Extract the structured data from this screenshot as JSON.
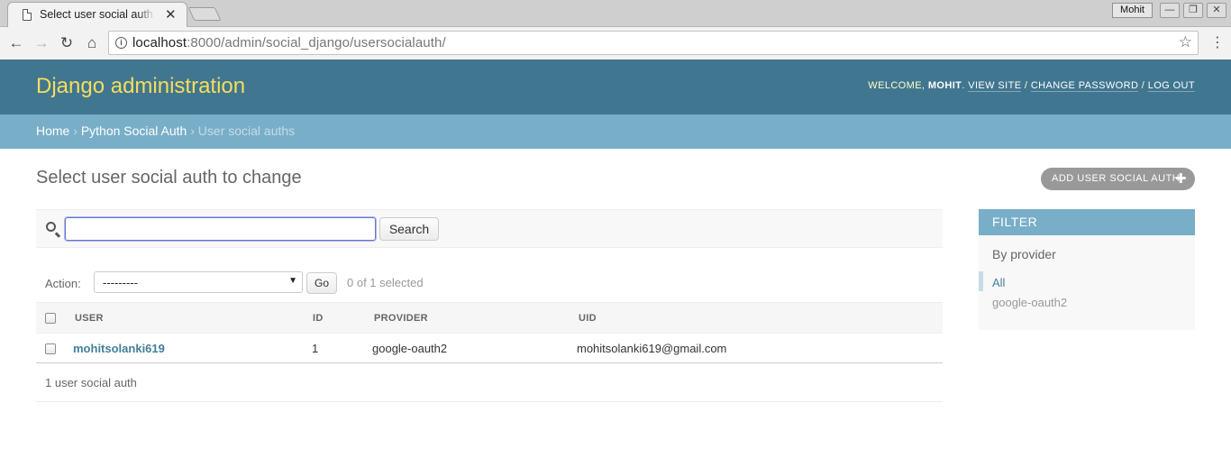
{
  "browser": {
    "tab_title": "Select user social auth to change",
    "profile_name": "Mohit",
    "url_host": "localhost",
    "url_rest": ":8000/admin/social_django/usersocialauth/"
  },
  "header": {
    "branding": "Django administration",
    "welcome": "WELCOME,",
    "username": "MOHIT",
    "view_site": "VIEW SITE",
    "change_password": "CHANGE PASSWORD",
    "log_out": "LOG OUT",
    "separator": " / "
  },
  "breadcrumbs": {
    "home": "Home",
    "app": "Python Social Auth",
    "current": "User social auths",
    "separator": " › "
  },
  "content": {
    "title": "Select user social auth to change",
    "add_button": "ADD USER SOCIAL AUTH"
  },
  "search": {
    "value": "",
    "button_label": "Search"
  },
  "actions": {
    "label": "Action:",
    "selected_option": "---------",
    "go_label": "Go",
    "counter": "0 of 1 selected"
  },
  "table": {
    "columns": [
      "USER",
      "ID",
      "PROVIDER",
      "UID"
    ],
    "rows": [
      {
        "user": "mohitsolanki619",
        "id": "1",
        "provider": "google-oauth2",
        "uid": "mohitsolanki619@gmail.com"
      }
    ]
  },
  "paginator": {
    "text": "1 user social auth"
  },
  "filter": {
    "heading": "FILTER",
    "by_label": "By provider",
    "options": [
      "All",
      "google-oauth2"
    ],
    "selected": "All"
  }
}
